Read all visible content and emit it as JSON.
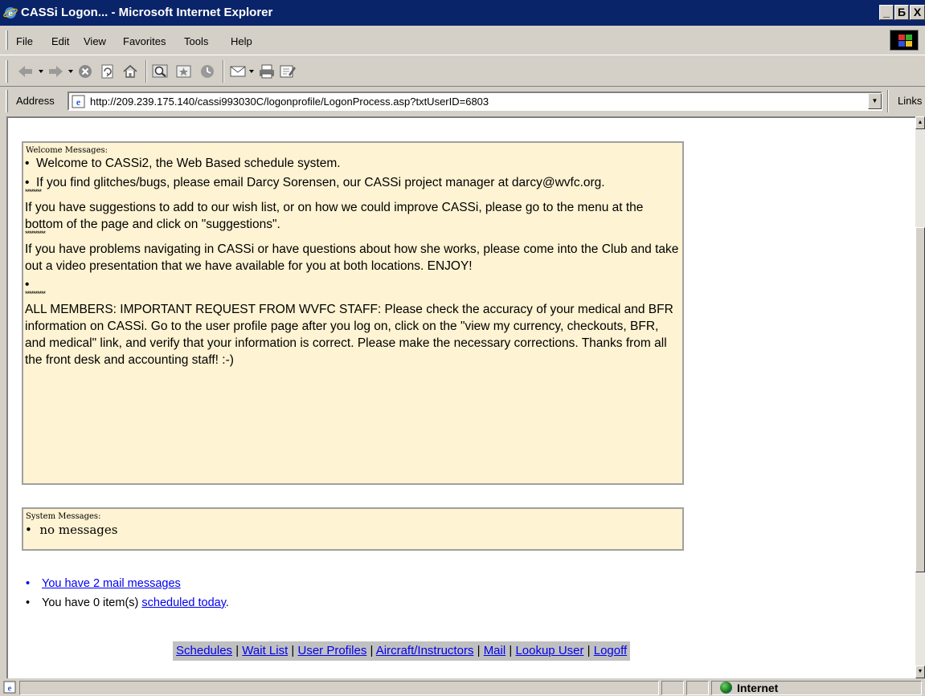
{
  "window": {
    "title": "CASSi Logon... - Microsoft Internet Explorer",
    "controls": [
      "_",
      "Б",
      "X"
    ]
  },
  "menu": [
    "File",
    "Edit",
    "View",
    "Favorites",
    "Tools",
    "Help"
  ],
  "toolbar_icons": [
    "back-icon",
    "forward-icon",
    "stop-icon",
    "refresh-icon",
    "home-icon",
    "search-icon",
    "favorites-icon",
    "history-icon",
    "mail-icon",
    "print-icon",
    "edit-icon"
  ],
  "address": {
    "label": "Address",
    "url": "http://209.239.175.140/cassi993030C/logonprofile/LogonProcess.asp?txtUserID=6803",
    "links_label": "Links"
  },
  "welcome": {
    "title": "Welcome Messages:",
    "line1": "Welcome to CASSi2, the Web Based schedule system.",
    "line2": "If you find glitches/bugs, please email Darcy Sorensen, our CASSi project manager at darcy@wvfc.org.",
    "stars1": "********",
    "para1": "If you have suggestions to add to our wish list, or on how we could improve CASSi, please go to the menu at the bottom of the page and click on \"suggestions\".",
    "stars2": "**********",
    "para2": "If you have problems navigating in CASSi or have questions about how she works, please come into the Club and take out a video presentation that we have available for you at both locations. ENJOY!",
    "stars3": "**********",
    "para3": "ALL MEMBERS: IMPORTANT REQUEST FROM WVFC STAFF: Please check the accuracy of your medical and BFR information on CASSi. Go to the user profile page after you log on, click on the \"view my currency, checkouts, BFR, and medical\" link, and verify that your information is correct. Please make the necessary corrections. Thanks from all the front desk and accounting staff! :-)"
  },
  "system": {
    "title": "System Messages:",
    "line1": "no messages"
  },
  "notices": {
    "mail_link": "You have 2 mail messages",
    "scheduled_prefix": "You have 0 item(s) ",
    "scheduled_link": "scheduled today",
    "scheduled_suffix": "."
  },
  "nav": {
    "sep": " | ",
    "schedules": "Schedules",
    "wait_list": "Wait List",
    "user_profiles": "User Profiles",
    "aircraft": "Aircraft/Instructors",
    "mail": "Mail",
    "lookup": "Lookup User",
    "logoff": "Logoff"
  },
  "status": {
    "zone": "Internet"
  }
}
